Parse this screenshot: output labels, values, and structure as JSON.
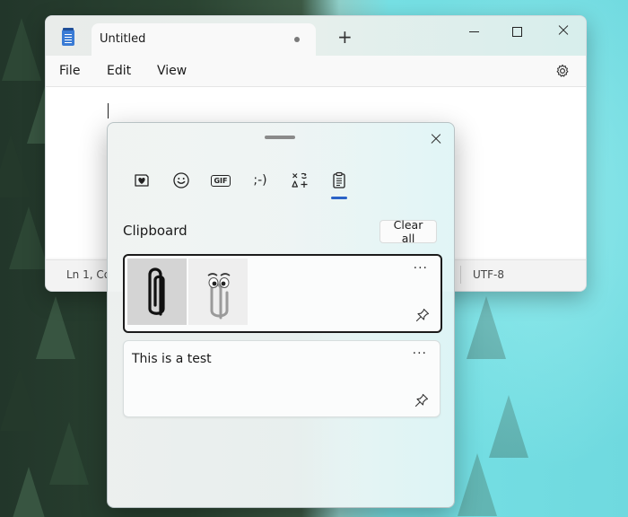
{
  "window": {
    "tab_title": "Untitled",
    "new_tab_label": "+"
  },
  "menu": {
    "file": "File",
    "edit": "Edit",
    "view": "View"
  },
  "status": {
    "position": "Ln 1, Co",
    "encoding": "UTF-8"
  },
  "flyout": {
    "tabs": [
      {
        "name": "stickers",
        "icon": "heart-sticker-icon"
      },
      {
        "name": "emoji",
        "icon": "smiley-icon"
      },
      {
        "name": "gif",
        "icon": "gif-icon",
        "label": "GIF"
      },
      {
        "name": "kaomoji",
        "icon": "kaomoji-icon",
        "label": ";-)"
      },
      {
        "name": "symbols",
        "icon": "symbols-icon"
      },
      {
        "name": "clipboard",
        "icon": "clipboard-icon",
        "active": true
      }
    ],
    "section_title": "Clipboard",
    "clear_all_label": "Clear all",
    "items": [
      {
        "type": "image",
        "icons": [
          "paperclip-icon",
          "clippy-icon"
        ]
      },
      {
        "type": "text",
        "text": "This is a test"
      }
    ],
    "more_label": "···"
  },
  "colors": {
    "accent": "#2a63c7",
    "notepad_icon": "#3a7bd5"
  }
}
